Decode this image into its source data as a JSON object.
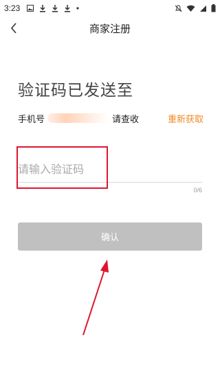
{
  "status_bar": {
    "time": "3:23",
    "left_icons": [
      "image-icon",
      "download-icon",
      "download-icon",
      "download-icon",
      "dot-icon"
    ],
    "right_icons": [
      "mute-icon",
      "wifi-icon",
      "signal-icon",
      "battery-icon"
    ]
  },
  "header": {
    "title": "商家注册",
    "back_icon": "chevron-left-icon"
  },
  "heading": "验证码已发送至",
  "phone_row": {
    "label": "手机号",
    "suffix": "请查收",
    "resend": "重新获取"
  },
  "code_input": {
    "placeholder": "请输入验证码",
    "value": "",
    "counter": "0/6"
  },
  "confirm_button": {
    "label": "确认"
  },
  "colors": {
    "accent": "#f08a24",
    "annotation": "#e0142e",
    "button_disabled": "#c0c0c0"
  }
}
